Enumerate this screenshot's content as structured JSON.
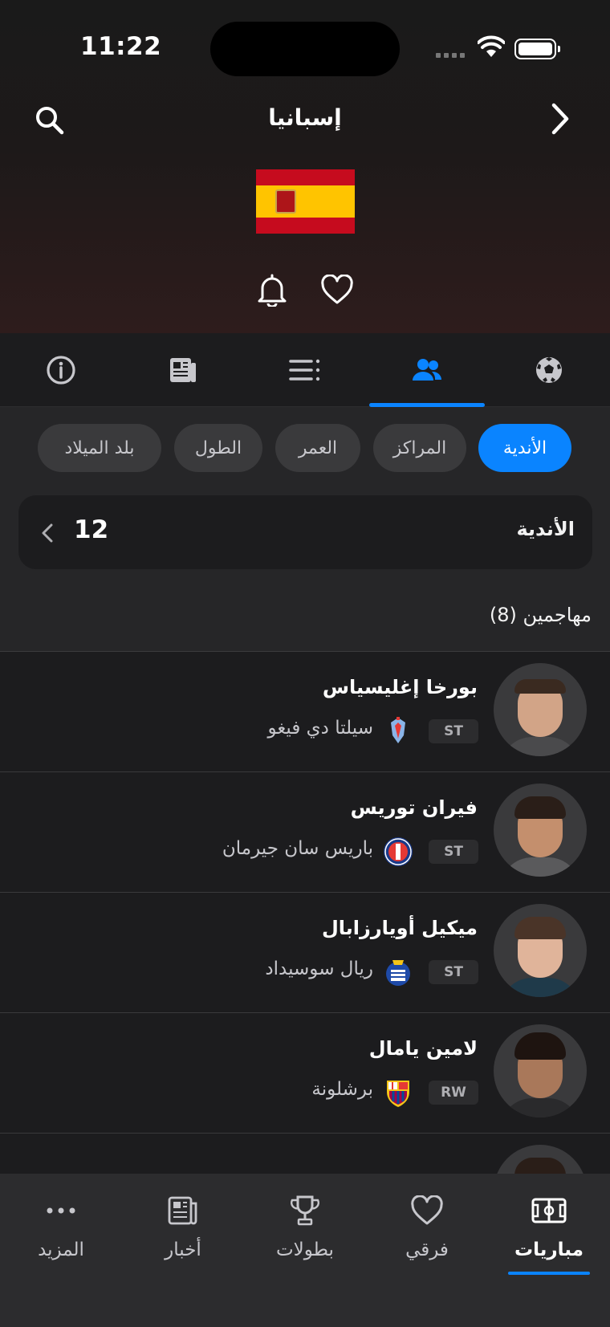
{
  "status_bar": {
    "time": "11:22"
  },
  "header": {
    "title": "إسبانيا"
  },
  "tabs": [
    {
      "name": "matches",
      "icon": "soccer-ball-icon"
    },
    {
      "name": "squad",
      "icon": "people-icon",
      "active": true
    },
    {
      "name": "standings",
      "icon": "list-icon"
    },
    {
      "name": "news",
      "icon": "newspaper-icon"
    },
    {
      "name": "info",
      "icon": "info-icon"
    }
  ],
  "filters": {
    "chips": [
      {
        "label": "الأندية",
        "active": true
      },
      {
        "label": "المراكز"
      },
      {
        "label": "العمر"
      },
      {
        "label": "الطول"
      },
      {
        "label": "بلد الميلاد"
      }
    ]
  },
  "clubs_card": {
    "label": "الأندية",
    "count": "12"
  },
  "section": {
    "title": "مهاجمين (8)"
  },
  "players": [
    {
      "name": "بورخا إغليسياس",
      "position": "ST",
      "club": "سيلتا دي فيغو",
      "club_logo": "celta-logo-icon"
    },
    {
      "name": "فيران توريس",
      "position": "ST",
      "club": "باريس سان جيرمان",
      "club_logo": "psg-logo-icon"
    },
    {
      "name": "ميكيل أويارزابال",
      "position": "ST",
      "club": "ريال سوسيداد",
      "club_logo": "real-sociedad-logo-icon"
    },
    {
      "name": "لامين يامال",
      "position": "RW",
      "club": "برشلونة",
      "club_logo": "barcelona-logo-icon"
    }
  ],
  "bottom_nav": {
    "items": [
      {
        "label": "مباريات",
        "icon": "pitch-icon",
        "active": true
      },
      {
        "label": "فرقي",
        "icon": "heart-icon"
      },
      {
        "label": "بطولات",
        "icon": "trophy-icon"
      },
      {
        "label": "أخبار",
        "icon": "newspaper-icon"
      },
      {
        "label": "المزيد",
        "icon": "more-icon"
      }
    ]
  },
  "colors": {
    "accent": "#0a84ff",
    "background": "#1c1c1e",
    "flag_red": "#c60b1e",
    "flag_yellow": "#ffc400"
  }
}
